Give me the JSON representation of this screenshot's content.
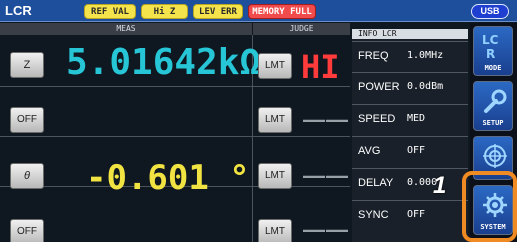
{
  "topbar": {
    "title": "LCR",
    "flags": [
      "REF VAL",
      "Hi Z",
      "LEV ERR",
      "MEMORY FULL"
    ],
    "usb": "USB"
  },
  "table": {
    "headers": {
      "meas": "MEAS",
      "judge": "JUDGE"
    },
    "rows": [
      {
        "param_button": "Z",
        "value": "5.01642kΩ",
        "value_color": "#27c6d6",
        "judge_button": "LMT",
        "judge_result": "HI"
      },
      {
        "param_button": "OFF",
        "value": "",
        "value_color": "#27c6d6",
        "judge_button": "LMT",
        "judge_result": "——"
      },
      {
        "param_button": "θ",
        "value": "-0.601 °",
        "value_color": "#f1e341",
        "judge_button": "LMT",
        "judge_result": "——"
      },
      {
        "param_button": "OFF",
        "value": "",
        "value_color": "#27c6d6",
        "judge_button": "LMT",
        "judge_result": "——"
      }
    ]
  },
  "info": {
    "title": "INFO LCR",
    "items": [
      {
        "label": "FREQ",
        "value": "1.0MHz"
      },
      {
        "label": "POWER",
        "value": "0.0dBm"
      },
      {
        "label": "SPEED",
        "value": "MED"
      },
      {
        "label": "AVG",
        "value": "OFF"
      },
      {
        "label": "DELAY",
        "value": "0.000"
      },
      {
        "label": "SYNC",
        "value": "OFF"
      }
    ]
  },
  "nav": {
    "mode": "MODE",
    "setup": "SETUP",
    "system": "SYSTEM"
  },
  "callout": {
    "number": "1"
  },
  "colors": {
    "accent": "#f08a22",
    "cyan": "#27c6d6",
    "yellow": "#f1e341",
    "red": "#ff3b3b"
  }
}
